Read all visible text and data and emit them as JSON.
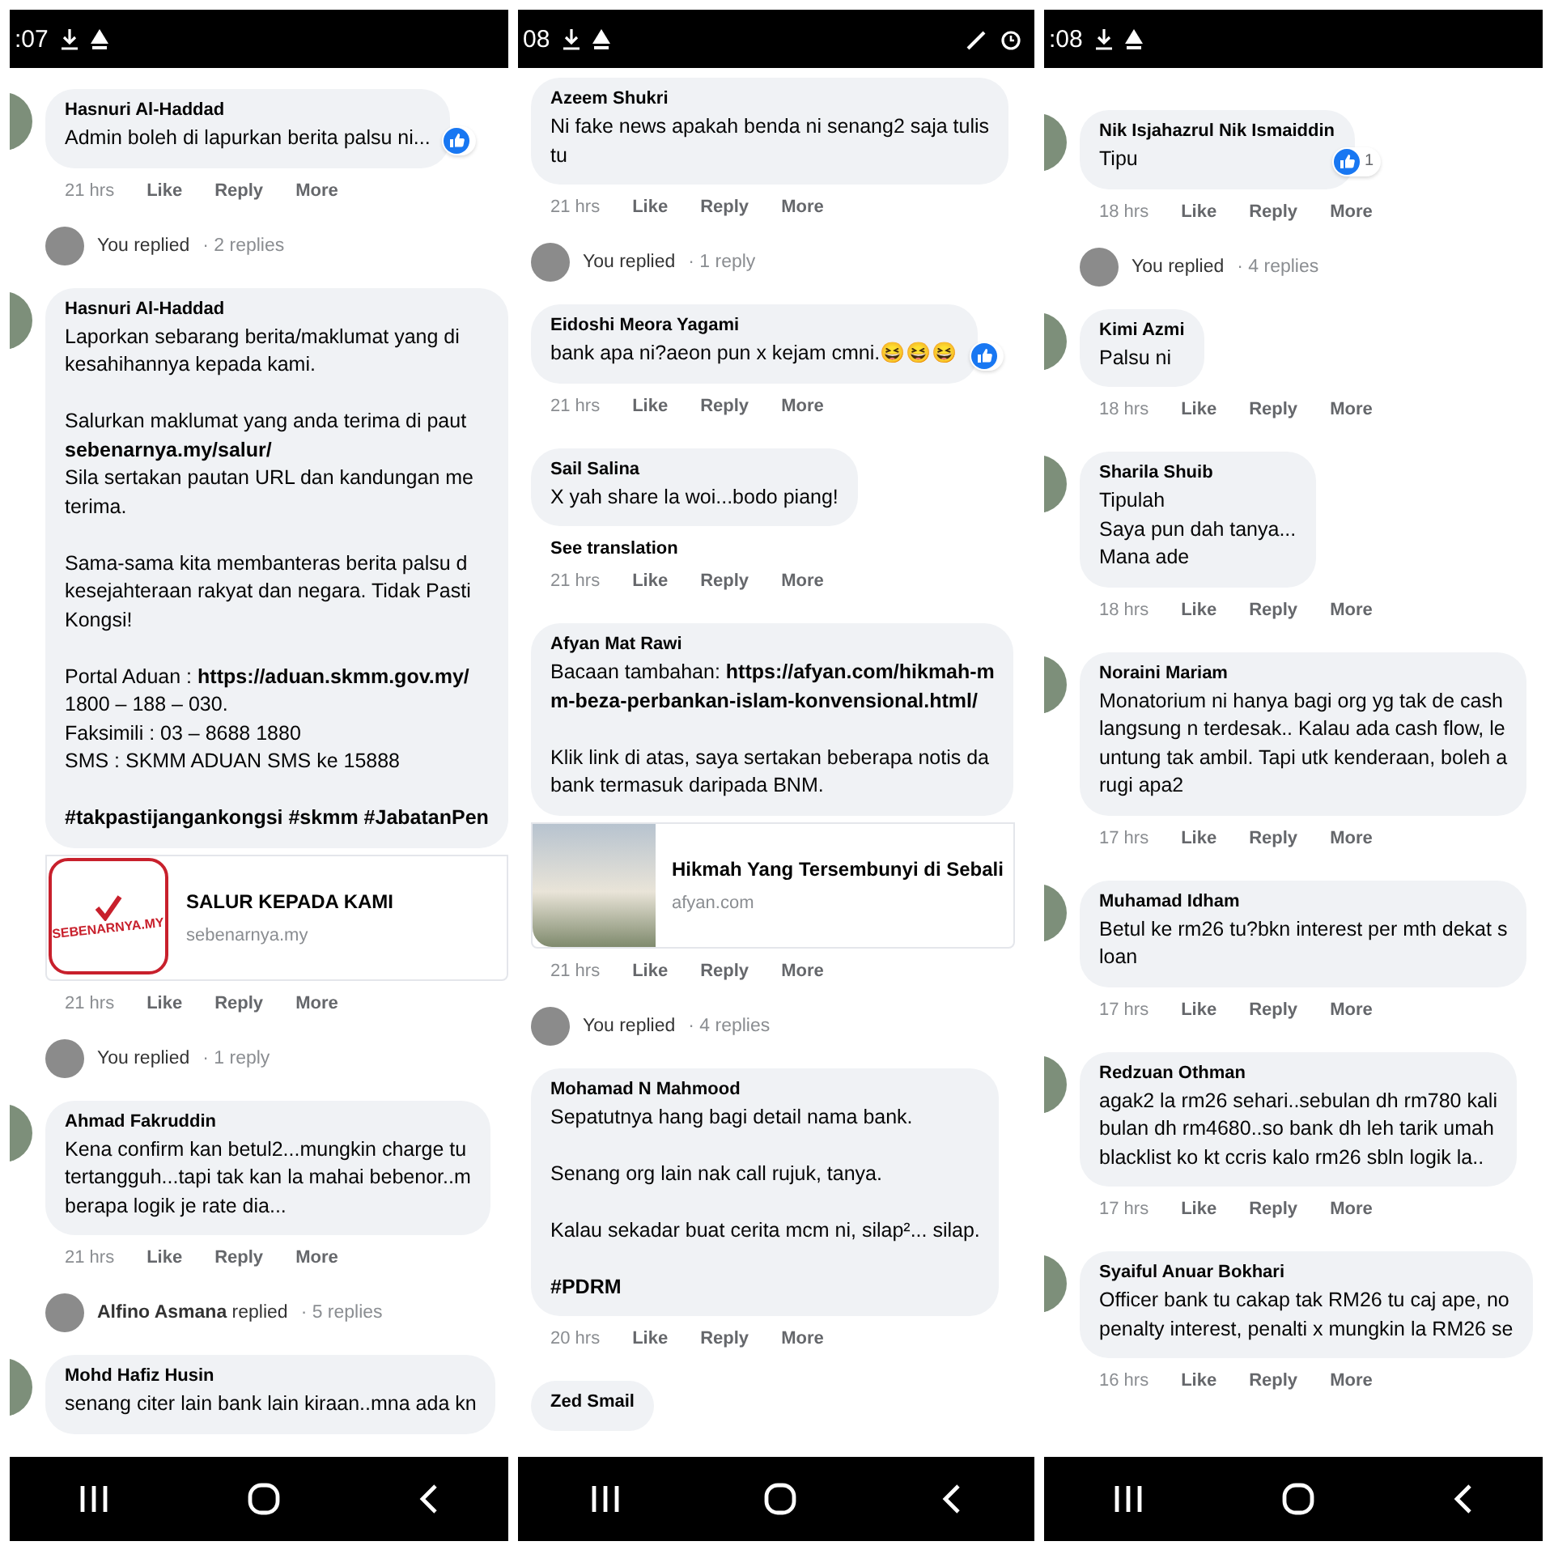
{
  "panels": [
    {
      "status": {
        "time": ":07"
      },
      "avatars_shown": true,
      "items": [
        {
          "kind": "comment",
          "author": "Hasnuri Al-Haddad",
          "paragraphs": [
            [
              "Admin boleh di lapurkan berita palsu ni..."
            ]
          ],
          "liked": true,
          "time": "21 hrs",
          "actions": [
            "Like",
            "Reply",
            "More"
          ]
        },
        {
          "kind": "replies",
          "who": "You replied",
          "count": "· 2 replies"
        },
        {
          "kind": "comment",
          "author": "Hasnuri Al-Haddad",
          "paragraphs": [
            [
              "Laporkan sebarang berita/maklumat yang di",
              "kesahihannya kepada kami."
            ],
            [
              "Salurkan maklumat yang anda terima di paut",
              "**sebenarnya.my/salur/**",
              "Sila sertakan pautan URL dan kandungan me",
              "terima."
            ],
            [
              "Sama-sama kita membanteras berita palsu d",
              "kesejahteraan rakyat dan negara. Tidak Pasti",
              "Kongsi!"
            ],
            [
              "Portal Aduan : **https://aduan.skmm.gov.my/**",
              "1800 – 188 – 030.",
              "Faksimili : 03 – 8688 1880",
              "SMS : SKMM ADUAN SMS ke 15888"
            ],
            [
              "**#takpastijangankongsi #skmm #JabatanPen**"
            ]
          ],
          "link": {
            "logo_text": "SEBENARNYA.MY",
            "title": "SALUR KEPADA KAMI",
            "domain": "sebenarnya.my"
          },
          "time": "21 hrs",
          "actions": [
            "Like",
            "Reply",
            "More"
          ]
        },
        {
          "kind": "replies",
          "who": "You replied",
          "count": "· 1 reply"
        },
        {
          "kind": "comment",
          "author": "Ahmad Fakruddin",
          "paragraphs": [
            [
              "Kena confirm kan betul2...mungkin charge tu",
              "tertangguh...tapi tak kan la mahai bebenor..m",
              "berapa logik je rate dia..."
            ]
          ],
          "time": "21 hrs",
          "actions": [
            "Like",
            "Reply",
            "More"
          ]
        },
        {
          "kind": "replies",
          "who": "**Alfino Asmana** replied",
          "count": "· 5 replies"
        },
        {
          "kind": "comment",
          "author": "Mohd Hafiz Husin",
          "paragraphs": [
            [
              "senang citer lain bank lain kiraan..mna ada kn"
            ]
          ]
        }
      ]
    },
    {
      "status": {
        "time": "08"
      },
      "avatars_shown": false,
      "items": [
        {
          "kind": "comment",
          "author": "Azeem Shukri",
          "paragraphs": [
            [
              "Ni fake news apakah benda ni senang2 saja tulis",
              "tu"
            ]
          ],
          "time": "21 hrs",
          "actions": [
            "Like",
            "Reply",
            "More"
          ]
        },
        {
          "kind": "replies",
          "who": "You replied",
          "count": "· 1 reply"
        },
        {
          "kind": "comment",
          "author": "Eidoshi Meora Yagami",
          "paragraphs": [
            [
              "bank apa ni?aeon pun x kejam cmni.😆😆😆"
            ]
          ],
          "liked": true,
          "time": "21 hrs",
          "actions": [
            "Like",
            "Reply",
            "More"
          ]
        },
        {
          "kind": "comment",
          "author": "Sail Salina",
          "paragraphs": [
            [
              "X yah share la woi...bodo piang!"
            ]
          ],
          "translation": "See translation",
          "time": "21 hrs",
          "actions": [
            "Like",
            "Reply",
            "More"
          ]
        },
        {
          "kind": "comment",
          "author": "Afyan Mat Rawi",
          "paragraphs": [
            [
              "Bacaan tambahan: **https://afyan.com/hikmah-m**",
              "**m-beza-perbankan-islam-konvensional.html/**"
            ],
            [
              "Klik link di atas, saya sertakan beberapa notis da",
              "bank termasuk daripada BNM."
            ]
          ],
          "link": {
            "title": "Hikmah Yang Tersembunyi di Sebali",
            "domain": "afyan.com"
          },
          "time": "21 hrs",
          "actions": [
            "Like",
            "Reply",
            "More"
          ]
        },
        {
          "kind": "replies",
          "who": "You replied",
          "count": "· 4 replies"
        },
        {
          "kind": "comment",
          "author": "Mohamad N Mahmood",
          "paragraphs": [
            [
              "Sepatutnya hang bagi detail nama bank."
            ],
            [
              "Senang org lain nak call rujuk, tanya."
            ],
            [
              "Kalau sekadar buat cerita mcm ni, silap²... silap."
            ],
            [
              "**#PDRM**"
            ]
          ],
          "time": "20 hrs",
          "actions": [
            "Like",
            "Reply",
            "More"
          ]
        },
        {
          "kind": "comment",
          "author": "Zed Smail"
        }
      ]
    },
    {
      "status": {
        "time": ":08"
      },
      "avatars_shown": true,
      "items": [
        {
          "kind": "comment",
          "author": "Nik Isjahazrul Nik Ismaiddin",
          "paragraphs": [
            [
              "Tipu"
            ]
          ],
          "liked": true,
          "like_count": "1",
          "time": "18 hrs",
          "actions": [
            "Like",
            "Reply",
            "More"
          ]
        },
        {
          "kind": "replies",
          "who": "You replied",
          "count": "· 4 replies"
        },
        {
          "kind": "comment",
          "author": "Kimi Azmi",
          "paragraphs": [
            [
              "Palsu ni"
            ]
          ],
          "time": "18 hrs",
          "actions": [
            "Like",
            "Reply",
            "More"
          ]
        },
        {
          "kind": "comment",
          "author": "Sharila Shuib",
          "paragraphs": [
            [
              "Tipulah",
              "Saya pun dah tanya...",
              "Mana ade"
            ]
          ],
          "time": "18 hrs",
          "actions": [
            "Like",
            "Reply",
            "More"
          ]
        },
        {
          "kind": "comment",
          "author": "Noraini Mariam",
          "paragraphs": [
            [
              "Monatorium ni hanya bagi org yg tak de cash",
              "langsung n terdesak.. Kalau ada cash flow, le",
              "untung tak ambil. Tapi utk kenderaan, boleh a",
              "rugi apa2"
            ]
          ],
          "time": "17 hrs",
          "actions": [
            "Like",
            "Reply",
            "More"
          ]
        },
        {
          "kind": "comment",
          "author": "Muhamad Idham",
          "paragraphs": [
            [
              "Betul ke rm26 tu?bkn interest per mth dekat s",
              "loan"
            ]
          ],
          "time": "17 hrs",
          "actions": [
            "Like",
            "Reply",
            "More"
          ]
        },
        {
          "kind": "comment",
          "author": "Redzuan Othman",
          "paragraphs": [
            [
              "agak2 la rm26 sehari..sebulan dh rm780 kali",
              "bulan dh rm4680..so bank dh leh tarik umah",
              "blacklist ko kt ccris kalo rm26 sbln logik la.."
            ]
          ],
          "time": "17 hrs",
          "actions": [
            "Like",
            "Reply",
            "More"
          ]
        },
        {
          "kind": "comment",
          "author": "Syaiful Anuar Bokhari",
          "paragraphs": [
            [
              "Officer bank tu cakap tak RM26 tu caj ape, no",
              "penalty interest, penalti x mungkin la RM26 se"
            ]
          ],
          "time": "16 hrs",
          "actions": [
            "Like",
            "Reply",
            "More"
          ]
        }
      ]
    }
  ]
}
